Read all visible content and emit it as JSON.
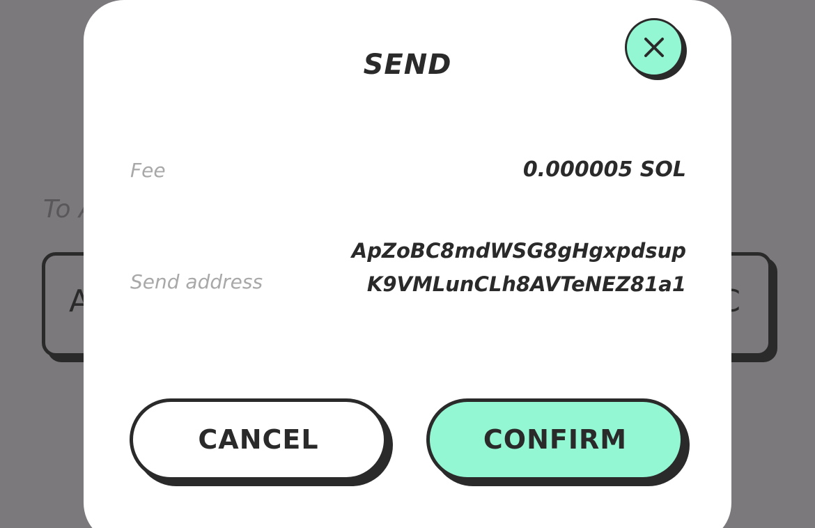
{
  "background": {
    "field_label": "To A",
    "field_left_text": "A",
    "field_right_text": "C"
  },
  "modal": {
    "title": "SEND",
    "close_icon": "close-icon",
    "fee": {
      "label": "Fee",
      "value": "0.000005 SOL"
    },
    "send_address": {
      "label": "Send address",
      "value": "ApZoBC8mdWSG8gHgxpdsupK9VMLunCLh8AVTeNEZ81a1"
    },
    "buttons": {
      "cancel": "CANCEL",
      "confirm": "CONFIRM"
    }
  },
  "colors": {
    "accent": "#93f7d3",
    "text_dark": "#2a2a2a",
    "overlay": "#7c797c",
    "label_gray": "#a8a8a8"
  }
}
